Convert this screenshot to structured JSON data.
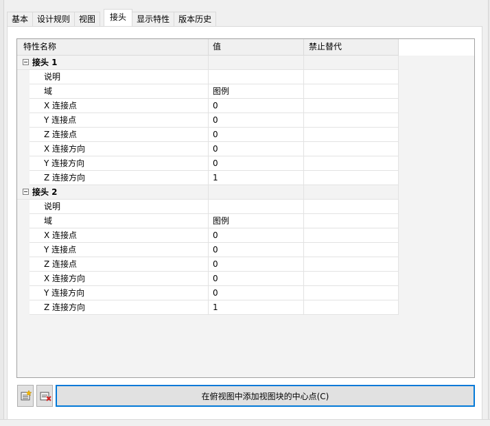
{
  "tabs": [
    {
      "label": "基本",
      "active": false
    },
    {
      "label": "设计规则",
      "active": false
    },
    {
      "label": "视图",
      "active": false
    },
    {
      "label": "接头",
      "active": true
    },
    {
      "label": "显示特性",
      "active": false
    },
    {
      "label": "版本历史",
      "active": false
    }
  ],
  "grid": {
    "headers": [
      "特性名称",
      "值",
      "禁止替代"
    ],
    "groups": [
      {
        "name": "接头 1",
        "rows": [
          {
            "name": "说明",
            "value": ""
          },
          {
            "name": "域",
            "value": "图例"
          },
          {
            "name": "X 连接点",
            "value": "0"
          },
          {
            "name": "Y 连接点",
            "value": "0"
          },
          {
            "name": "Z 连接点",
            "value": "0"
          },
          {
            "name": "X 连接方向",
            "value": "0"
          },
          {
            "name": "Y 连接方向",
            "value": "0"
          },
          {
            "name": "Z 连接方向",
            "value": "1"
          }
        ]
      },
      {
        "name": "接头 2",
        "rows": [
          {
            "name": "说明",
            "value": ""
          },
          {
            "name": "域",
            "value": "图例"
          },
          {
            "name": "X 连接点",
            "value": "0"
          },
          {
            "name": "Y 连接点",
            "value": "0"
          },
          {
            "name": "Z 连接点",
            "value": "0"
          },
          {
            "name": "X 连接方向",
            "value": "0"
          },
          {
            "name": "Y 连接方向",
            "value": "0"
          },
          {
            "name": "Z 连接方向",
            "value": "1"
          }
        ]
      }
    ]
  },
  "buttons": {
    "add_icon": "add-connector-icon",
    "delete_icon": "delete-connector-icon",
    "main_label": "在俯视图中添加视图块的中心点(C)"
  }
}
